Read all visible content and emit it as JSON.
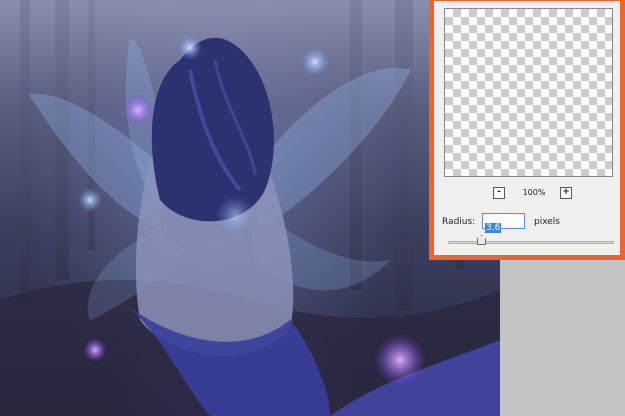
{
  "canvas": {
    "description_layer": "photo-artwork"
  },
  "dialog": {
    "accent_color": "#f0632a",
    "zoom": {
      "out_label": "-",
      "level": "100%",
      "in_label": "+"
    },
    "radius": {
      "label": "Radius:",
      "value": "3.6",
      "unit": "pixels",
      "slider_fraction": 0.2
    }
  }
}
